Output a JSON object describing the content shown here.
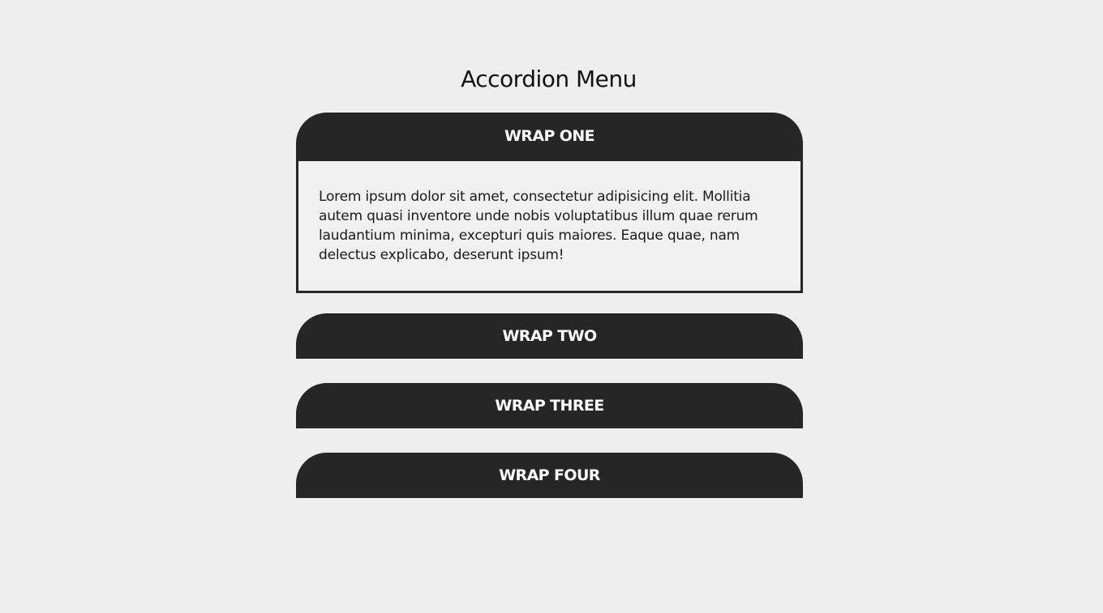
{
  "page": {
    "title": "Accordion Menu"
  },
  "accordion": {
    "items": [
      {
        "label": "WRAP ONE",
        "expanded": true,
        "content": "Lorem ipsum dolor sit amet, consectetur adipisicing elit. Mollitia autem quasi inventore unde nobis voluptatibus illum quae rerum laudantium minima, excepturi quis maiores. Eaque quae, nam delectus explicabo, deserunt ipsum!"
      },
      {
        "label": "WRAP TWO",
        "expanded": false
      },
      {
        "label": "WRAP THREE",
        "expanded": false
      },
      {
        "label": "WRAP FOUR",
        "expanded": false
      }
    ]
  },
  "colors": {
    "background": "#eeeeee",
    "header_bg": "#262626",
    "header_text": "#ffffff",
    "body_text": "#1a1a1a"
  }
}
